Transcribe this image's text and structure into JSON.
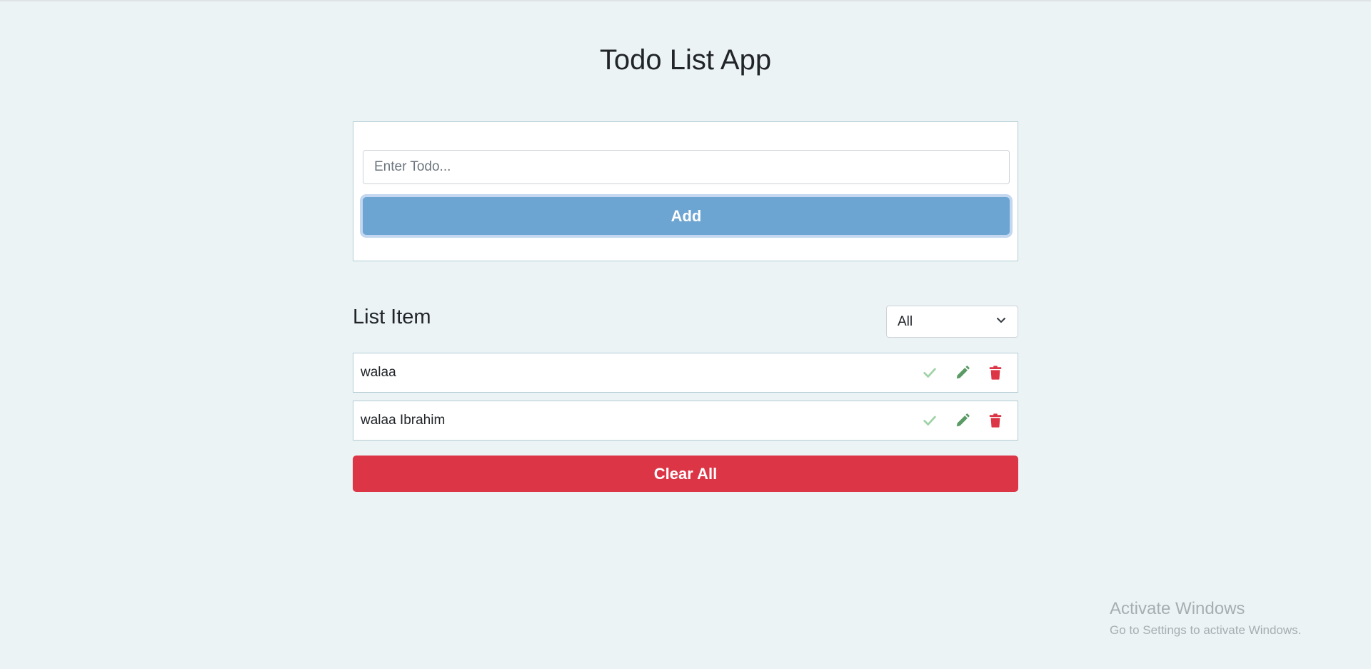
{
  "app": {
    "title": "Todo List App"
  },
  "form": {
    "placeholder": "Enter Todo...",
    "value": "",
    "add_label": "Add"
  },
  "list": {
    "heading": "List Item",
    "filter": {
      "selected": "All"
    },
    "items": [
      {
        "text": "walaa"
      },
      {
        "text": "walaa Ibrahim"
      }
    ],
    "clear_label": "Clear All"
  },
  "icons": {
    "complete": "check-icon",
    "edit": "pencil-icon",
    "delete": "trash-icon",
    "dropdown": "chevron-down-icon"
  },
  "colors": {
    "background": "#ebf3f5",
    "add_button": "#6ca4d2",
    "clear_button": "#dc3545",
    "check": "#9fd3a6",
    "edit": "#5a9a64",
    "delete": "#dc3545"
  },
  "watermark": {
    "title": "Activate Windows",
    "subtitle": "Go to Settings to activate Windows."
  }
}
